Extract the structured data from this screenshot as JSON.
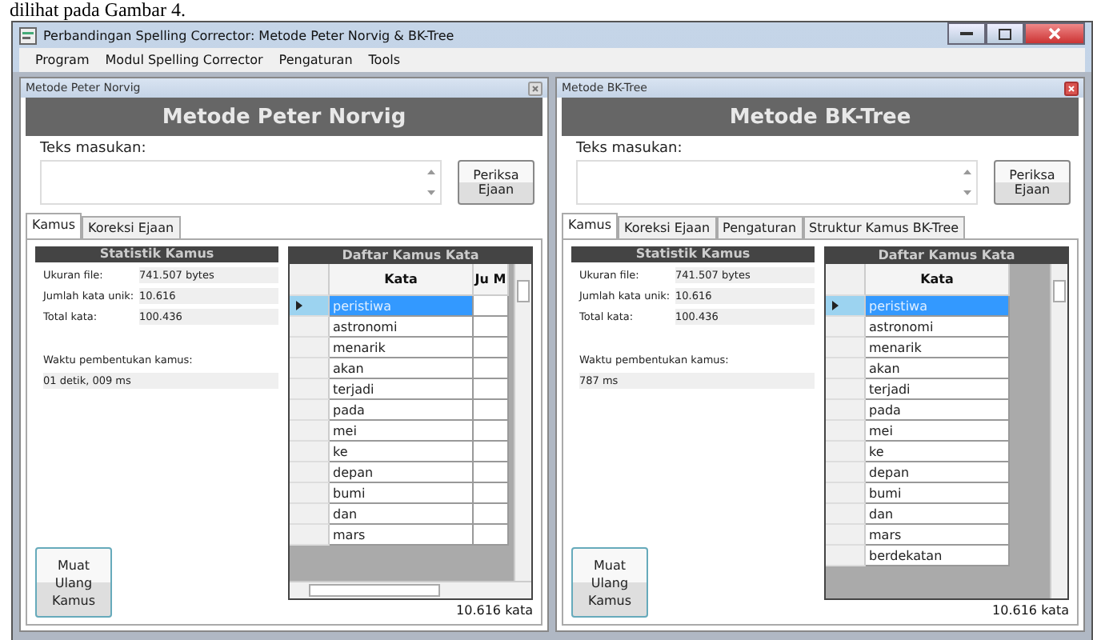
{
  "document_caption": "dilihat pada Gambar 4.",
  "window": {
    "title": "Perbandingan Spelling Corrector: Metode Peter Norvig & BK-Tree"
  },
  "menu": [
    "Program",
    "Modul Spelling Corrector",
    "Pengaturan",
    "Tools"
  ],
  "panels": [
    {
      "caption": "Metode Peter Norvig",
      "active": false,
      "heading": "Metode Peter Norvig",
      "input_label": "Teks masukan:",
      "check_button": "Periksa Ejaan",
      "tabs": [
        {
          "label": "Kamus",
          "selected": true
        },
        {
          "label": "Koreksi Ejaan",
          "selected": false
        }
      ],
      "stats_title": "Statistik Kamus",
      "stats": [
        {
          "label": "Ukuran file:",
          "value": "741.507 bytes"
        },
        {
          "label": "Jumlah kata unik:",
          "value": "10.616"
        },
        {
          "label": "Total kata:",
          "value": "100.436"
        }
      ],
      "build_time_label": "Waktu pembentukan kamus:",
      "build_time": "01 detik, 009 ms",
      "list_title": "Daftar Kamus Kata",
      "columns": [
        "Kata",
        "Ju M"
      ],
      "horizontal_scrollbar": true,
      "rows": [
        {
          "word": "peristiwa",
          "selected": true
        },
        {
          "word": "astronomi",
          "selected": false
        },
        {
          "word": "menarik",
          "selected": false
        },
        {
          "word": "akan",
          "selected": false
        },
        {
          "word": "terjadi",
          "selected": false
        },
        {
          "word": "pada",
          "selected": false
        },
        {
          "word": "mei",
          "selected": false
        },
        {
          "word": "ke",
          "selected": false
        },
        {
          "word": "depan",
          "selected": false
        },
        {
          "word": "bumi",
          "selected": false
        },
        {
          "word": "dan",
          "selected": false
        },
        {
          "word": "mars",
          "selected": false
        }
      ],
      "count": "10.616 kata",
      "reload_button": "Muat Ulang Kamus"
    },
    {
      "caption": "Metode BK-Tree",
      "active": true,
      "heading": "Metode BK-Tree",
      "input_label": "Teks masukan:",
      "check_button": "Periksa Ejaan",
      "tabs": [
        {
          "label": "Kamus",
          "selected": true
        },
        {
          "label": "Koreksi Ejaan",
          "selected": false
        },
        {
          "label": "Pengaturan",
          "selected": false
        },
        {
          "label": "Struktur Kamus BK-Tree",
          "selected": false
        }
      ],
      "stats_title": "Statistik Kamus",
      "stats": [
        {
          "label": "Ukuran file:",
          "value": "741.507 bytes"
        },
        {
          "label": "Jumlah kata unik:",
          "value": "10.616"
        },
        {
          "label": "Total kata:",
          "value": "100.436"
        }
      ],
      "build_time_label": "Waktu pembentukan kamus:",
      "build_time": "787 ms",
      "list_title": "Daftar Kamus Kata",
      "columns": [
        "Kata"
      ],
      "horizontal_scrollbar": false,
      "rows": [
        {
          "word": "peristiwa",
          "selected": true
        },
        {
          "word": "astronomi",
          "selected": false
        },
        {
          "word": "menarik",
          "selected": false
        },
        {
          "word": "akan",
          "selected": false
        },
        {
          "word": "terjadi",
          "selected": false
        },
        {
          "word": "pada",
          "selected": false
        },
        {
          "word": "mei",
          "selected": false
        },
        {
          "word": "ke",
          "selected": false
        },
        {
          "word": "depan",
          "selected": false
        },
        {
          "word": "bumi",
          "selected": false
        },
        {
          "word": "dan",
          "selected": false
        },
        {
          "word": "mars",
          "selected": false
        },
        {
          "word": "berdekatan",
          "selected": false
        }
      ],
      "count": "10.616 kata",
      "reload_button": "Muat Ulang Kamus"
    }
  ]
}
